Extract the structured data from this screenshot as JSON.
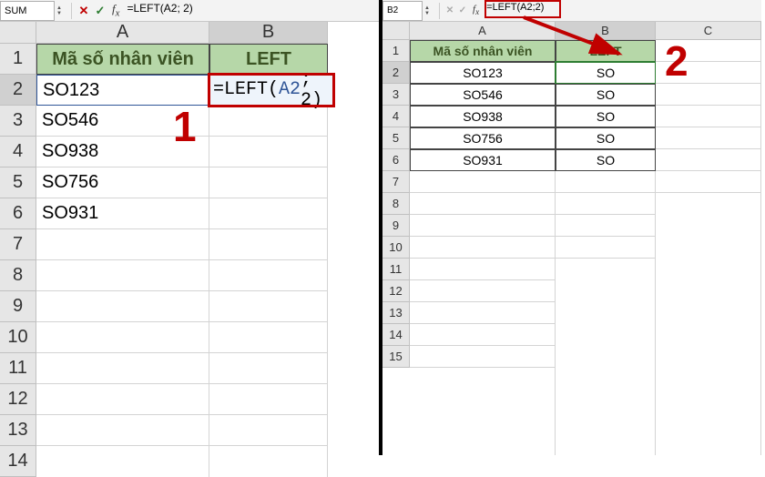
{
  "left": {
    "namebox": "SUM",
    "formula": "=LEFT(A2; 2)",
    "colHeaders": [
      "A",
      "B"
    ],
    "rowCount": 14,
    "hdrRow": {
      "a": "Mã số nhân viên",
      "b": "LEFT"
    },
    "dataA": [
      "SO123",
      "SO546",
      "SO938",
      "SO756",
      "SO931"
    ],
    "editCell": {
      "prefix": "=LEFT(",
      "ref": "A2",
      "suffix": "; 2)"
    },
    "annot": "1"
  },
  "right": {
    "namebox": "B2",
    "formula": "=LEFT(A2;2)",
    "colHeaders": [
      "A",
      "B",
      "C"
    ],
    "rowCount": 15,
    "hdrRow": {
      "a": "Mã số nhân viên",
      "b": "LEFT"
    },
    "rows": [
      {
        "a": "SO123",
        "b": "SO"
      },
      {
        "a": "SO546",
        "b": "SO"
      },
      {
        "a": "SO938",
        "b": "SO"
      },
      {
        "a": "SO756",
        "b": "SO"
      },
      {
        "a": "SO931",
        "b": "SO"
      }
    ],
    "annot": "2"
  }
}
